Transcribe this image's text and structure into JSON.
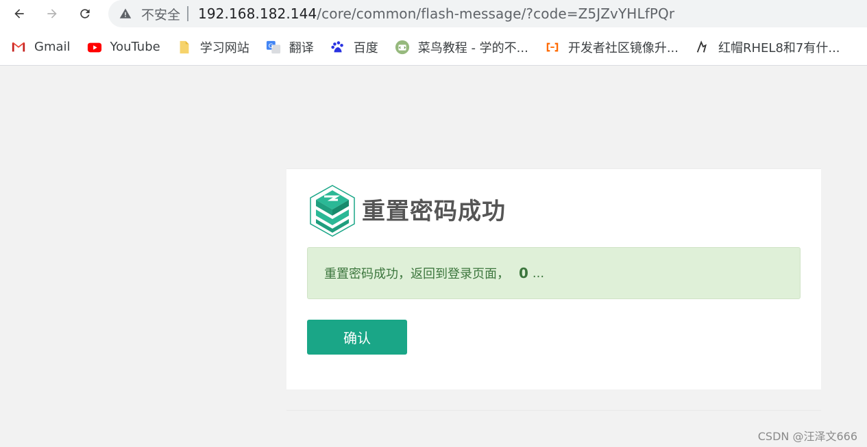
{
  "browser": {
    "security_label": "不安全",
    "url_host": "192.168.182.144",
    "url_path": "/core/common/flash-message/?code=Z5JZvYHLfPQr",
    "icons": [
      "back-arrow-icon",
      "forward-arrow-icon",
      "reload-icon",
      "warning-triangle-icon"
    ]
  },
  "bookmarks": [
    {
      "label": "Gmail",
      "icon": "gmail-icon"
    },
    {
      "label": "YouTube",
      "icon": "youtube-icon"
    },
    {
      "label": "学习网站",
      "icon": "folder-icon"
    },
    {
      "label": "翻译",
      "icon": "translate-icon"
    },
    {
      "label": "百度",
      "icon": "baidu-icon"
    },
    {
      "label": "菜鸟教程 - 学的不...",
      "icon": "runoob-icon"
    },
    {
      "label": "开发者社区镜像升...",
      "icon": "aliyun-icon"
    },
    {
      "label": "红帽RHEL8和7有什...",
      "icon": "redhat-icon"
    }
  ],
  "card": {
    "title": "重置密码成功",
    "message": "重置密码成功，返回到登录页面，",
    "countdown": "0",
    "ellipsis": "...",
    "confirm_label": "确认"
  },
  "watermark": "CSDN @汪泽文666",
  "colors": {
    "accent": "#1aa687",
    "alert_bg": "#dff0d8",
    "alert_text": "#3c763d"
  }
}
